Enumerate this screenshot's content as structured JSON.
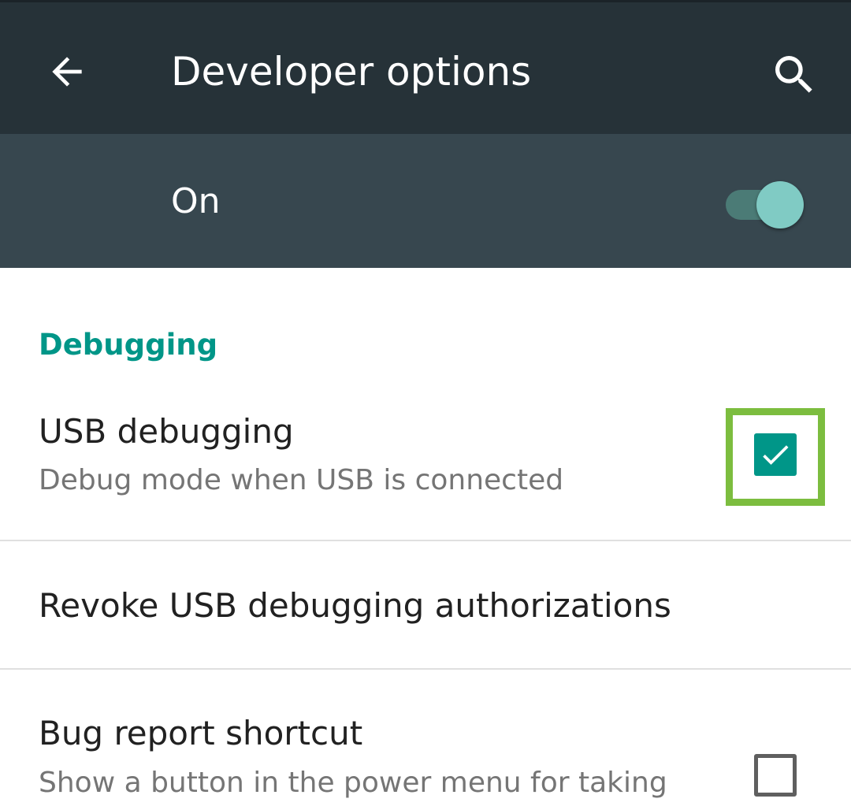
{
  "app_bar": {
    "title": "Developer options",
    "back_icon": "arrow-back-icon",
    "search_icon": "search-icon",
    "background": "#263238"
  },
  "master_switch": {
    "label": "On",
    "state": "on",
    "background": "#37474f",
    "accent": "#80cbc4"
  },
  "section": {
    "header": "Debugging",
    "accent": "#009688"
  },
  "preferences": [
    {
      "title": "USB debugging",
      "summary": "Debug mode when USB is connected",
      "control": "checkbox",
      "checked": true,
      "highlighted": true,
      "highlight_color": "#7cbd3f"
    },
    {
      "title": "Revoke USB debugging authorizations",
      "control": "none"
    },
    {
      "title": "Bug report shortcut",
      "summary": "Show a button in the power menu for taking",
      "control": "checkbox",
      "checked": false
    }
  ]
}
